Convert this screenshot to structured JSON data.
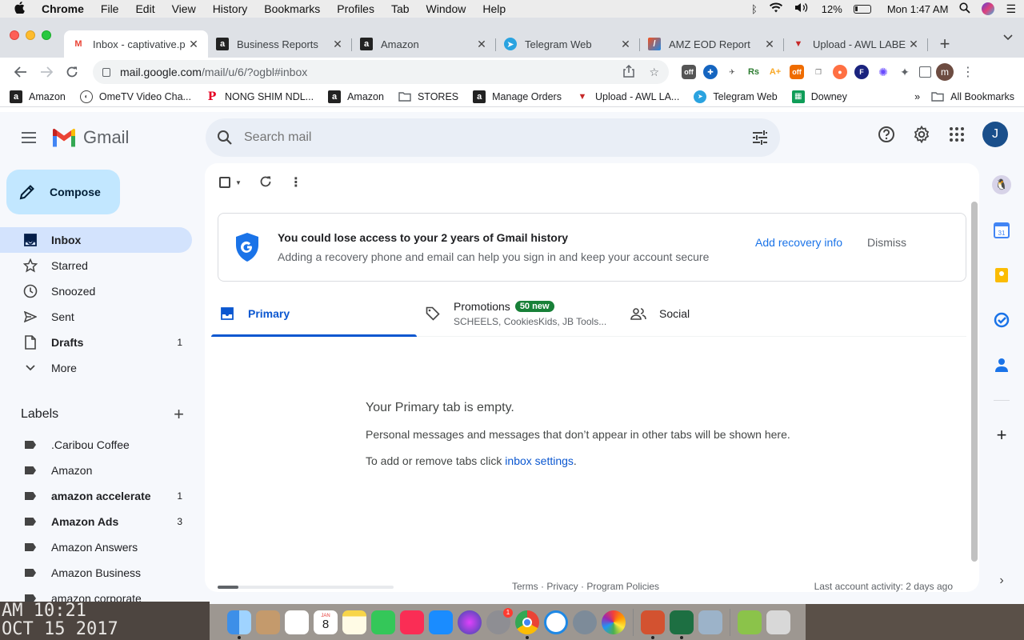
{
  "menubar": {
    "app": "Chrome",
    "items": [
      "File",
      "Edit",
      "View",
      "History",
      "Bookmarks",
      "Profiles",
      "Tab",
      "Window",
      "Help"
    ],
    "battery": "12%",
    "clock": "Mon 1:47 AM"
  },
  "tabs": [
    {
      "title": "Inbox - captivative.p",
      "favicon": "gmail-icon",
      "active": true
    },
    {
      "title": "Business Reports",
      "favicon": "amazon-icon",
      "active": false
    },
    {
      "title": "Amazon",
      "favicon": "amazon-icon",
      "active": false
    },
    {
      "title": "Telegram Web",
      "favicon": "telegram-icon",
      "active": false
    },
    {
      "title": "AMZ EOD Report",
      "favicon": "report-icon",
      "active": false
    },
    {
      "title": "Upload - AWL LABE",
      "favicon": "awl-icon",
      "active": false
    }
  ],
  "omnibox": {
    "host": "mail.google.com",
    "path": "/mail/u/6/?ogbl#inbox"
  },
  "profile_initial": "m",
  "bookmarks": [
    {
      "label": "Amazon",
      "icon": "amazon-icon"
    },
    {
      "label": "OmeTV Video Cha...",
      "icon": "ometv-icon"
    },
    {
      "label": "NONG SHIM NDL...",
      "icon": "pinterest-icon"
    },
    {
      "label": "Amazon",
      "icon": "amazon-icon"
    },
    {
      "label": "STORES",
      "icon": "folder-icon"
    },
    {
      "label": "Manage Orders",
      "icon": "amazon-icon"
    },
    {
      "label": "Upload - AWL LA...",
      "icon": "awl-icon"
    },
    {
      "label": "Telegram Web",
      "icon": "telegram-icon"
    },
    {
      "label": "Downey",
      "icon": "sheets-icon"
    }
  ],
  "bookmarks_more": "»",
  "all_bookmarks": "All Bookmarks",
  "gmail": {
    "brand": "Gmail",
    "search_placeholder": "Search mail",
    "avatar_initial": "J",
    "compose": "Compose",
    "nav": [
      {
        "label": "Inbox",
        "icon": "inbox-icon",
        "count": "",
        "active": true,
        "bold": true
      },
      {
        "label": "Starred",
        "icon": "star-icon",
        "count": "",
        "active": false,
        "bold": false
      },
      {
        "label": "Snoozed",
        "icon": "clock-icon",
        "count": "",
        "active": false,
        "bold": false
      },
      {
        "label": "Sent",
        "icon": "send-icon",
        "count": "",
        "active": false,
        "bold": false
      },
      {
        "label": "Drafts",
        "icon": "draft-icon",
        "count": "1",
        "active": false,
        "bold": true
      },
      {
        "label": "More",
        "icon": "chevron-down-icon",
        "count": "",
        "active": false,
        "bold": false
      }
    ],
    "labels_title": "Labels",
    "labels": [
      {
        "label": ".Caribou Coffee",
        "count": "",
        "bold": false
      },
      {
        "label": "Amazon",
        "count": "",
        "bold": false
      },
      {
        "label": "amazon accelerate",
        "count": "1",
        "bold": true
      },
      {
        "label": "Amazon Ads",
        "count": "3",
        "bold": true
      },
      {
        "label": "Amazon Answers",
        "count": "",
        "bold": false
      },
      {
        "label": "Amazon Business",
        "count": "",
        "bold": false
      },
      {
        "label": "amazon corporate",
        "count": "",
        "bold": false
      }
    ],
    "banner": {
      "title": "You could lose access to your 2 years of Gmail history",
      "subtitle": "Adding a recovery phone and email can help you sign in and keep your account secure",
      "action": "Add recovery info",
      "dismiss": "Dismiss"
    },
    "inbox_tabs": {
      "primary": "Primary",
      "promotions": "Promotions",
      "promotions_badge": "50 new",
      "promotions_sub": "SCHEELS, CookiesKids, JB Tools...",
      "social": "Social"
    },
    "empty": {
      "heading": "Your Primary tab is empty.",
      "body": "Personal messages and messages that don’t appear in other tabs will be shown here.",
      "settings_prefix": "To add or remove tabs click ",
      "settings_link": "inbox settings",
      "settings_suffix": "."
    },
    "footer": {
      "links": "Terms · Privacy · Program Policies",
      "activity": "Last account activity: 2 days ago"
    }
  },
  "desktop": {
    "line1": "AM 10:21",
    "line2": "OCT 15 2017"
  },
  "dock": {
    "calendar_month": "JAN",
    "calendar_day": "8",
    "settings_badge": "1"
  },
  "colors": {
    "gmail_blue": "#0b57d0",
    "compose_bg": "#c2e7ff",
    "active_nav": "#d3e3fd",
    "badge_green": "#188038"
  }
}
